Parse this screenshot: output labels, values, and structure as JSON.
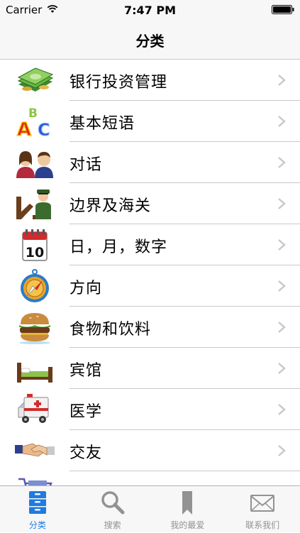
{
  "status_bar": {
    "carrier": "Carrier",
    "time": "7:47 PM"
  },
  "nav": {
    "title": "分类"
  },
  "categories": [
    {
      "label": "银行投资管理",
      "icon": "money-icon"
    },
    {
      "label": "基本短语",
      "icon": "abc-blocks-icon"
    },
    {
      "label": "对话",
      "icon": "people-icon"
    },
    {
      "label": "边界及海关",
      "icon": "customs-officer-icon"
    },
    {
      "label": "日，月，数字",
      "icon": "calendar-icon"
    },
    {
      "label": "方向",
      "icon": "compass-icon"
    },
    {
      "label": "食物和饮料",
      "icon": "burger-icon"
    },
    {
      "label": "宾馆",
      "icon": "bed-icon"
    },
    {
      "label": "医学",
      "icon": "ambulance-icon"
    },
    {
      "label": "交友",
      "icon": "handshake-icon"
    }
  ],
  "calendar_day": "10",
  "tabs": [
    {
      "label": "分类",
      "icon": "cabinet-icon",
      "active": true
    },
    {
      "label": "搜索",
      "icon": "search-icon",
      "active": false
    },
    {
      "label": "我的最爱",
      "icon": "bookmark-icon",
      "active": false
    },
    {
      "label": "联系我们",
      "icon": "envelope-icon",
      "active": false
    }
  ],
  "colors": {
    "accent": "#1e7be0",
    "inactive": "#929292",
    "bar_bg": "#f7f7f7",
    "separator": "#c8c7cc"
  }
}
